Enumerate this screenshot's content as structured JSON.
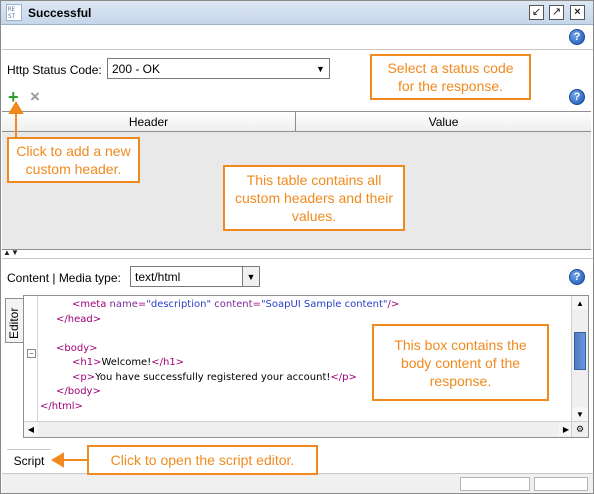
{
  "window": {
    "icon_text": "RE ST",
    "title": "Successful"
  },
  "response": {
    "status_label": "Http Status Code:",
    "status_value": "200 - OK"
  },
  "headers_table": {
    "columns": [
      "Header",
      "Value"
    ]
  },
  "content": {
    "media_label": "Content | Media type:",
    "media_value": "text/html",
    "editor_tab": "Editor",
    "code_lines": [
      {
        "indent": 2,
        "parts": [
          [
            "tag",
            "<meta "
          ],
          [
            "attr",
            "name"
          ],
          [
            "tag",
            "="
          ],
          [
            "val",
            "\"description\""
          ],
          [
            "tag",
            " "
          ],
          [
            "attr",
            "content"
          ],
          [
            "tag",
            "="
          ],
          [
            "val",
            "\"SoapUI Sample content\""
          ],
          [
            "tag",
            "/>"
          ]
        ]
      },
      {
        "indent": 1,
        "parts": [
          [
            "tag",
            "</head>"
          ]
        ]
      },
      {
        "indent": 0,
        "parts": []
      },
      {
        "indent": 1,
        "parts": [
          [
            "tag",
            "<body>"
          ]
        ]
      },
      {
        "indent": 2,
        "parts": [
          [
            "tag",
            "<h1>"
          ],
          [
            "txt",
            "Welcome!"
          ],
          [
            "tag",
            "</h1>"
          ]
        ]
      },
      {
        "indent": 2,
        "parts": [
          [
            "tag",
            "<p>"
          ],
          [
            "txt",
            "You have successfully registered your account!"
          ],
          [
            "tag",
            "</p>"
          ]
        ]
      },
      {
        "indent": 1,
        "parts": [
          [
            "tag",
            "</body>"
          ]
        ]
      },
      {
        "indent": 0,
        "parts": [
          [
            "tag",
            "</html>"
          ]
        ]
      }
    ]
  },
  "script": {
    "tab_label": "Script"
  },
  "callouts": {
    "status": "Select a status code for the response.",
    "add_header": "Click to add a new custom header.",
    "table": "This table contains all custom headers and their values.",
    "body": "This box contains the body content of the response.",
    "script": "Click to open the script editor."
  },
  "icons": {
    "help": "?",
    "add": "+",
    "remove": "×",
    "minimize": "↙",
    "restore": "↗",
    "close": "×"
  },
  "colors": {
    "callout": "#f08a1e",
    "tag": "#a0007a",
    "value": "#2a3fc8",
    "add_icon": "#2e9e2e"
  }
}
